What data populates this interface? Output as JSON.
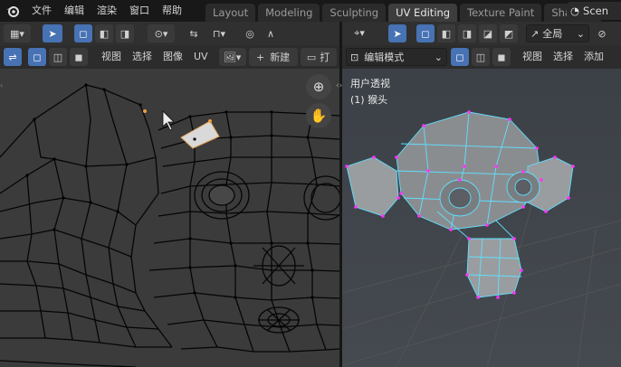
{
  "menu": [
    "文件",
    "编辑",
    "渲染",
    "窗口",
    "帮助"
  ],
  "workspace_tabs": [
    {
      "label": "Layout",
      "active": false
    },
    {
      "label": "Modeling",
      "active": false
    },
    {
      "label": "Sculpting",
      "active": false
    },
    {
      "label": "UV Editing",
      "active": true
    },
    {
      "label": "Texture Paint",
      "active": false
    },
    {
      "label": "Shading",
      "active": false
    }
  ],
  "scene": {
    "label": "Scen"
  },
  "uv_editor": {
    "header_menu": [
      "视图",
      "选择",
      "图像",
      "UV"
    ],
    "new_button": "新建",
    "open_label": "打"
  },
  "viewport": {
    "mode_select": "编辑模式",
    "transform_orientation": "全局",
    "menu": [
      "视图",
      "选择",
      "添加"
    ],
    "overlay_title": "用户透视",
    "overlay_object": "(1) 猴头"
  },
  "colors": {
    "accent": "#4772b3",
    "selected_vertex": "#ff33ff",
    "mesh_edge_selected": "#56d7ff"
  }
}
